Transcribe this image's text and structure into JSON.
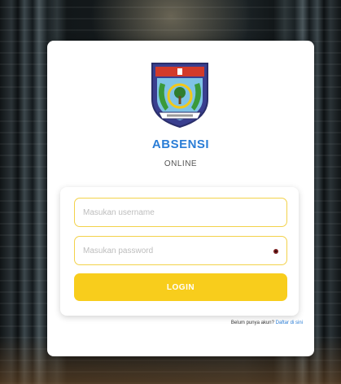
{
  "login_card": {
    "app_title": "ABSENSI",
    "app_subtitle": "ONLINE",
    "username_placeholder": "Masukan username",
    "password_placeholder": "Masukan password",
    "login_label": "LOGIN",
    "register_prompt": "Belum punya akun?",
    "register_link": "Daftar di sini",
    "eye_icon": "eye-icon",
    "logo_icon": "regional-emblem-logo"
  },
  "colors": {
    "accent_yellow": "#f8cd1c",
    "input_border": "#f3d24a",
    "title_blue": "#2a7dd6",
    "card_bg": "#ffffff"
  }
}
